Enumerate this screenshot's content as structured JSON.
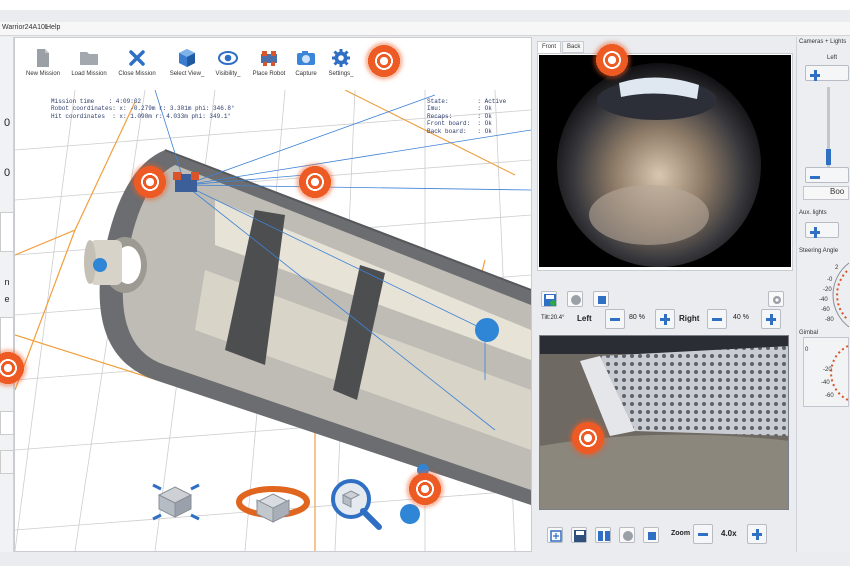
{
  "window": {
    "title": "Warrior24A10L"
  },
  "menu": [
    "Help"
  ],
  "left_panel": {
    "values": [
      "0",
      "0",
      "n",
      "e"
    ]
  },
  "toolbar": [
    {
      "label": "New Mission",
      "icon": "document-icon"
    },
    {
      "label": "Load Mission",
      "icon": "folder-icon"
    },
    {
      "label": "Close Mission",
      "icon": "close-icon"
    },
    {
      "label": "Select View_",
      "icon": "cube-icon"
    },
    {
      "label": "Visibility_",
      "icon": "eye-icon"
    },
    {
      "label": "Place Robot",
      "icon": "robot-icon"
    },
    {
      "label": "Capture",
      "icon": "camera-icon"
    },
    {
      "label": "Settings_",
      "icon": "gear-icon"
    }
  ],
  "info_left": "Mission time    : 4:09:02\nRobot coordinates: x: -0.279m r: 3.301m phi: 346.8°\nHit coordinates  : x: 1.090m r: 4.033m phi: 349.1°",
  "info_right": "State:        : Active\nImu:          : Ok\nRecaps:       : Ok\nFront board:  : Ok\nBack board:   : Ok",
  "camera_tabs": [
    "Front",
    "Back"
  ],
  "lights": {
    "tilt": "Tilt:20.4°",
    "left_label": "Left",
    "left_value": "80 %",
    "right_label": "Right",
    "right_value": "40 %"
  },
  "zoom": {
    "label": "Zoom",
    "value": "4.0x"
  },
  "right_panel": {
    "section_cameras": "Cameras + Lights",
    "left_label": "Left",
    "boost_label": "Boo",
    "aux_lights": "Aux. lights",
    "steering": "Steering Angle",
    "gimbal": "Gimbal",
    "steering_ticks": [
      "2",
      "-0",
      "-20",
      "-40",
      "-60",
      "-80"
    ],
    "gimbal_ticks": [
      "0",
      "-20",
      "-40",
      "-60"
    ]
  },
  "colors": {
    "accent": "#ee5a24",
    "blue": "#2f6fc4",
    "grid": "#c9c9c9",
    "orange_line": "#f0a040"
  }
}
